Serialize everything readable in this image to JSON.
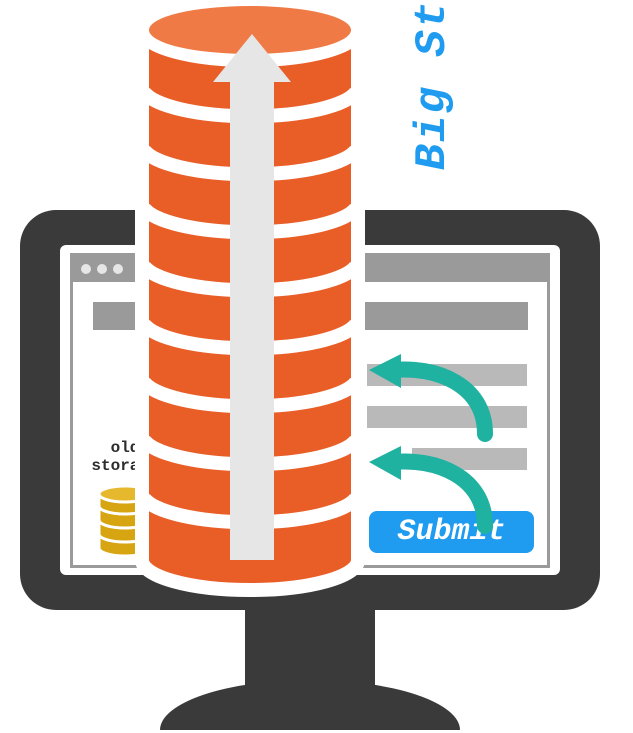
{
  "diagram": {
    "big_storage_label": "Big Storage",
    "old_storage_label_line1": "old",
    "old_storage_label_line2": "storage",
    "submit_label": "Submit",
    "colors": {
      "monitor": "#3a3a3a",
      "browser_chrome": "#9a9a9a",
      "content_bar": "#b9b9b9",
      "big_cylinder": "#e95d27",
      "big_cylinder_outline": "#ffffff",
      "arrow_band": "#e6e6e6",
      "label_blue": "#1f9cf0",
      "submit_bg": "#1f9cf0",
      "submit_text": "#ffffff",
      "old_cylinder": "#d7a511",
      "flow_arrow": "#1fb2a0"
    }
  }
}
